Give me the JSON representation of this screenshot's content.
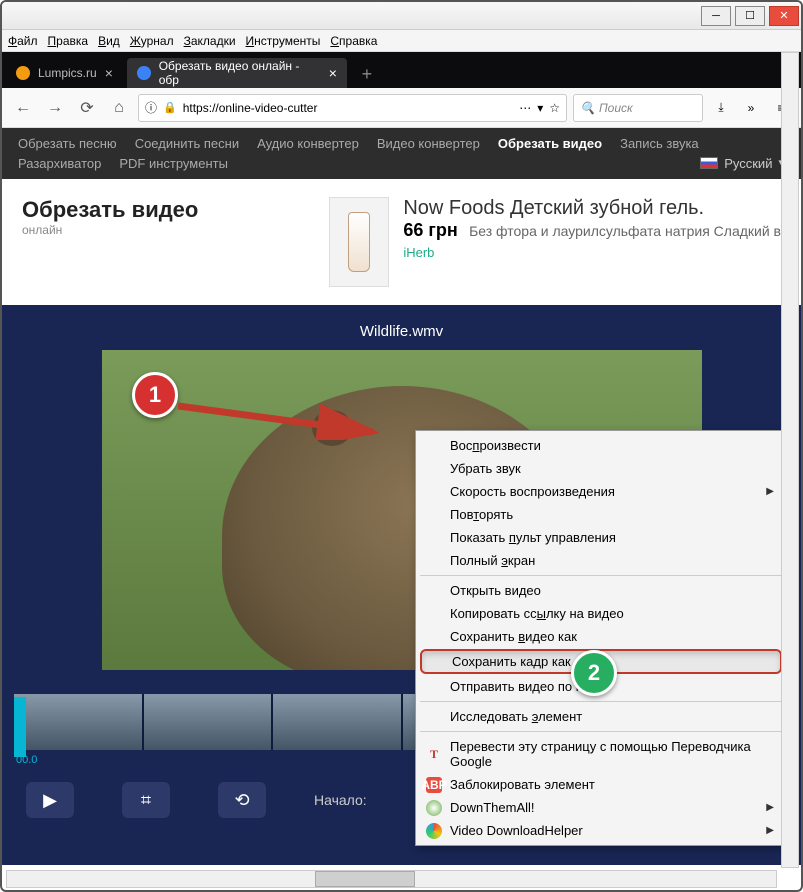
{
  "menubar": [
    "Файл",
    "Правка",
    "Вид",
    "Журнал",
    "Закладки",
    "Инструменты",
    "Справка"
  ],
  "tabs": {
    "t1": "Lumpics.ru",
    "t2": "Обрезать видео онлайн - обр"
  },
  "url": "https://online-video-cutter",
  "search_placeholder": "Поиск",
  "sitemenu": {
    "items": [
      "Обрезать песню",
      "Соединить песни",
      "Аудио конвертер",
      "Видео конвертер",
      "Обрезать видео",
      "Запись звука",
      "Разархиватор",
      "PDF инструменты"
    ],
    "lang": "Русский"
  },
  "hero": {
    "title": "Обрезать видео",
    "subtitle": "онлайн"
  },
  "ad": {
    "title": "Now Foods Детский зубной гель.",
    "price": "66 грн",
    "desc": "Без фтора и лаурилсульфата натрия Сладкий в",
    "brand": "iHerb"
  },
  "editor": {
    "filename": "Wildlife.wmv",
    "timecode": "00.0",
    "start_label": "Начало:"
  },
  "markers": {
    "m1": "1",
    "m2": "2"
  },
  "ctx": {
    "play": "Воспроизвести",
    "mute": "Убрать звук",
    "speed": "Скорость воспроизведения",
    "repeat": "Повторять",
    "controls": "Показать пульт управления",
    "fullscreen": "Полный экран",
    "openvideo": "Открыть видео",
    "copylink": "Копировать ссылку на видео",
    "savevideo": "Сохранить видео как",
    "saveframe": "Сохранить кадр как…",
    "email": "Отправить видео по почте",
    "inspect": "Исследовать элемент",
    "translate": "Перевести эту страницу с помощью Переводчика Google",
    "block": "Заблокировать элемент",
    "dta": "DownThemAll!",
    "vdh": "Video DownloadHelper"
  }
}
